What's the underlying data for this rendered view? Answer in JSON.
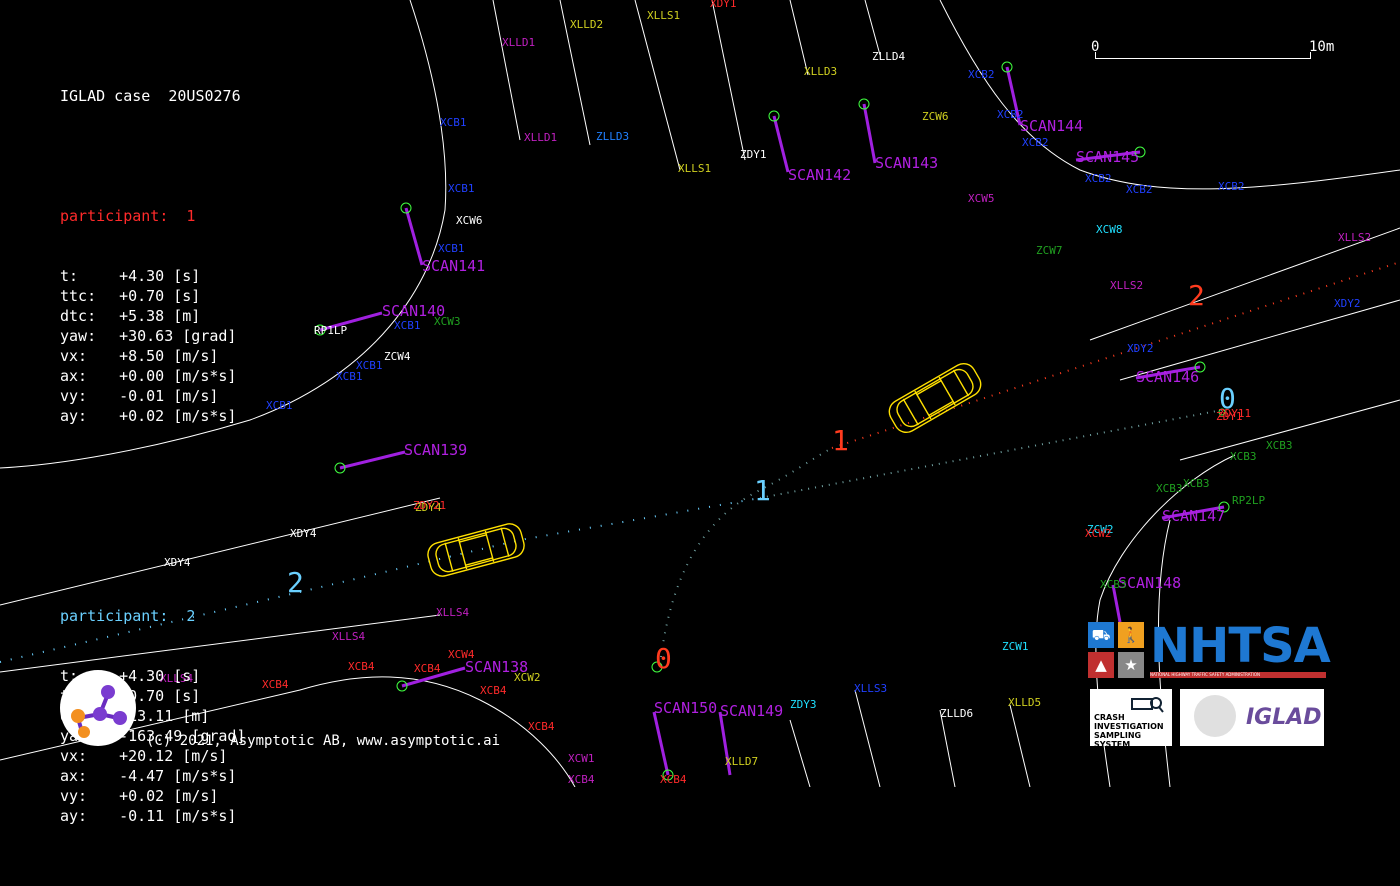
{
  "case": {
    "label": "IGLAD case",
    "id": "20US0276"
  },
  "participants": [
    {
      "title": "participant:  1",
      "color": "#ff2a2a",
      "rows": [
        {
          "k": "t:",
          "v": "+4.30 [s]"
        },
        {
          "k": "ttc:",
          "v": "+0.70 [s]"
        },
        {
          "k": "dtc:",
          "v": "+5.38 [m]"
        },
        {
          "k": "yaw:",
          "v": "+30.63 [grad]"
        },
        {
          "k": "vx:",
          "v": "+8.50 [m/s]"
        },
        {
          "k": "ax:",
          "v": "+0.00 [m/s*s]"
        },
        {
          "k": "vy:",
          "v": "-0.01 [m/s]"
        },
        {
          "k": "ay:",
          "v": "+0.02 [m/s*s]"
        }
      ]
    },
    {
      "title": "participant:  2",
      "color": "#6ad0ff",
      "rows": [
        {
          "k": "t:",
          "v": "+4.30 [s]"
        },
        {
          "k": "ttc:",
          "v": "+0.70 [s]"
        },
        {
          "k": "dtc:",
          "v": "+13.11 [m]"
        },
        {
          "k": "yaw:",
          "v": "-163.49 [grad]"
        },
        {
          "k": "vx:",
          "v": "+20.12 [m/s]"
        },
        {
          "k": "ax:",
          "v": "-4.47 [m/s*s]"
        },
        {
          "k": "vy:",
          "v": "+0.02 [m/s]"
        },
        {
          "k": "ay:",
          "v": "-0.11 [m/s*s]"
        }
      ]
    }
  ],
  "scale": {
    "start": "0",
    "end": "10m"
  },
  "copyright": "(C) 2021, Asymptotic AB, www.asymptotic.ai",
  "logos": {
    "nhtsa": "NHTSA",
    "nhtsa_sub": "NATIONAL HIGHWAY TRAFFIC SAFETY ADMINISTRATION",
    "cism": [
      "CRASH",
      "INVESTIGATION",
      "SAMPLING SYSTEM"
    ],
    "iglad": "IGLAD"
  },
  "trajectory_markers": [
    {
      "text": "0",
      "color": "#ff3b1e"
    },
    {
      "text": "1",
      "color": "#ff3b1e"
    },
    {
      "text": "2",
      "color": "#ff3b1e"
    },
    {
      "text": "0",
      "color": "#6ad0ff"
    },
    {
      "text": "1",
      "color": "#6ad0ff"
    },
    {
      "text": "2",
      "color": "#6ad0ff"
    }
  ],
  "scan_labels": [
    "SCAN138",
    "SCAN139",
    "SCAN140",
    "SCAN141",
    "SCAN142",
    "SCAN143",
    "SCAN144",
    "SCAN145",
    "SCAN146",
    "SCAN147",
    "SCAN148",
    "SCAN149",
    "SCAN150"
  ],
  "map_labels": [
    {
      "t": "XLLD2",
      "c": "#d0d020"
    },
    {
      "t": "XLLS1",
      "c": "#d0d020"
    },
    {
      "t": "XLLD1",
      "c": "#c020c0"
    },
    {
      "t": "XLLD3",
      "c": "#d0d020"
    },
    {
      "t": "ZLLD4",
      "c": "#ffffff"
    },
    {
      "t": "XCB2",
      "c": "#2040ff"
    },
    {
      "t": "XCB1",
      "c": "#2040ff"
    },
    {
      "t": "XLLD1",
      "c": "#c020c0"
    },
    {
      "t": "ZLLD3",
      "c": "#2080ff"
    },
    {
      "t": "ZDY1",
      "c": "#ffffff"
    },
    {
      "t": "XLLS1",
      "c": "#d0d020"
    },
    {
      "t": "ZCW6",
      "c": "#d0d020"
    },
    {
      "t": "XCB2",
      "c": "#2040ff"
    },
    {
      "t": "XCB2",
      "c": "#2040ff"
    },
    {
      "t": "XCB1",
      "c": "#2040ff"
    },
    {
      "t": "XCW6",
      "c": "#ffffff"
    },
    {
      "t": "XCB1",
      "c": "#2040ff"
    },
    {
      "t": "XCW5",
      "c": "#c020c0"
    },
    {
      "t": "XCB2",
      "c": "#2040ff"
    },
    {
      "t": "XCB2",
      "c": "#2040ff"
    },
    {
      "t": "XCB2",
      "c": "#2040ff"
    },
    {
      "t": "XCW8",
      "c": "#20e0ff"
    },
    {
      "t": "ZCW7",
      "c": "#20a020"
    },
    {
      "t": "XLLS2",
      "c": "#c020c0"
    },
    {
      "t": "XLLS2",
      "c": "#c020c0"
    },
    {
      "t": "XDY2",
      "c": "#2040ff"
    },
    {
      "t": "XDY2",
      "c": "#2040ff"
    },
    {
      "t": "RP1LP",
      "c": "#ffffff"
    },
    {
      "t": "XCB1",
      "c": "#2040ff"
    },
    {
      "t": "XCW3",
      "c": "#20a020"
    },
    {
      "t": "ZCW4",
      "c": "#ffffff"
    },
    {
      "t": "XCB1",
      "c": "#2040ff"
    },
    {
      "t": "XCB1",
      "c": "#2040ff"
    },
    {
      "t": "XCB1",
      "c": "#2040ff"
    },
    {
      "t": "ZDY1",
      "c": "#ff2a2a"
    },
    {
      "t": "XCB3",
      "c": "#20a020"
    },
    {
      "t": "XCB3",
      "c": "#20a020"
    },
    {
      "t": "XCB3",
      "c": "#20a020"
    },
    {
      "t": "RP2LP",
      "c": "#20a020"
    },
    {
      "t": "ZDY4",
      "c": "#d0d020"
    },
    {
      "t": "ZDY21",
      "c": "#ff2a2a"
    },
    {
      "t": "XDY4",
      "c": "#ffffff"
    },
    {
      "t": "XDY4",
      "c": "#ffffff"
    },
    {
      "t": "ZCW2",
      "c": "#20e0ff"
    },
    {
      "t": "XCW2",
      "c": "#ff2a2a"
    },
    {
      "t": "XCB3",
      "c": "#20a020"
    },
    {
      "t": "XCB3",
      "c": "#20a020"
    },
    {
      "t": "XLLS4",
      "c": "#c020c0"
    },
    {
      "t": "XLLS4",
      "c": "#c020c0"
    },
    {
      "t": "XLLS4",
      "c": "#c020c0"
    },
    {
      "t": "XCW4",
      "c": "#ff2a2a"
    },
    {
      "t": "XCB4",
      "c": "#ff2a2a"
    },
    {
      "t": "XCB4",
      "c": "#ff2a2a"
    },
    {
      "t": "XCB4",
      "c": "#ff2a2a"
    },
    {
      "t": "XCB4",
      "c": "#ff2a2a"
    },
    {
      "t": "XCB4",
      "c": "#ff2a2a"
    },
    {
      "t": "XCW2",
      "c": "#d0d020"
    },
    {
      "t": "ZCW1",
      "c": "#20e0ff"
    },
    {
      "t": "ZDY3",
      "c": "#20e0ff"
    },
    {
      "t": "XLLS3",
      "c": "#2040ff"
    },
    {
      "t": "ZLLD6",
      "c": "#ffffff"
    },
    {
      "t": "XLLD5",
      "c": "#d0d020"
    },
    {
      "t": "XLLD7",
      "c": "#d0d020"
    },
    {
      "t": "XCW1",
      "c": "#c020c0"
    },
    {
      "t": "XCB4",
      "c": "#c020c0"
    },
    {
      "t": "XCB4",
      "c": "#ff2a2a"
    },
    {
      "t": "XDY1",
      "c": "#ff2a2a"
    },
    {
      "t": "ZDY11",
      "c": "#ff2a2a"
    }
  ]
}
